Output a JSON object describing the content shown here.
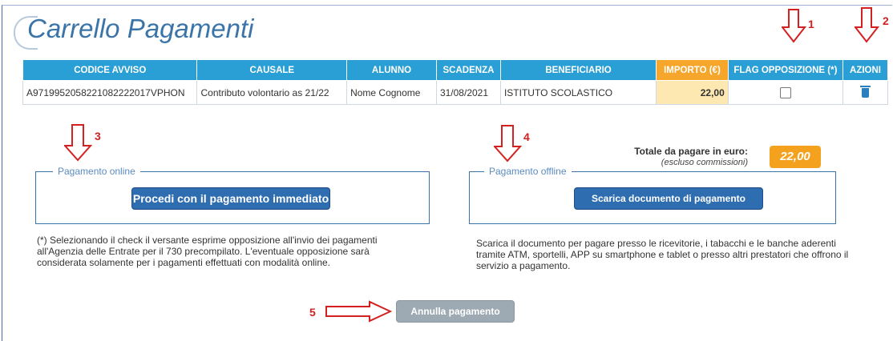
{
  "page": {
    "title": "Carrello Pagamenti"
  },
  "table": {
    "headers": {
      "codice_avviso": "CODICE AVVISO",
      "causale": "CAUSALE",
      "alunno": "ALUNNO",
      "scadenza": "SCADENZA",
      "beneficiario": "BENEFICIARIO",
      "importo": "IMPORTO (€)",
      "flag_opposizione": "FLAG OPPOSIZIONE (*)",
      "azioni": "AZIONI"
    },
    "row": {
      "codice_avviso": "A9719952058221082222017VPHON",
      "causale": "Contributo volontario as 21/22",
      "alunno": "Nome Cognome",
      "scadenza": "31/08/2021",
      "beneficiario": "ISTITUTO SCOLASTICO",
      "importo": "22,00",
      "flag_opposizione_checked": false,
      "azione_icon": "trash-icon"
    }
  },
  "totale": {
    "label": "Totale da pagare in euro:",
    "sublabel": "(escluso commissioni)",
    "value": "22,00"
  },
  "online": {
    "legend": "Pagamento online",
    "button": "Procedi con il pagamento immediato",
    "note": "(*) Selezionando il check il versante esprime opposizione all'invio dei pagamenti all'Agenzia delle Entrate per il 730 precompilato. L'eventuale opposizione sarà considerata solamente per i pagamenti effettuati con modalità online."
  },
  "offline": {
    "legend": "Pagamento offline",
    "button": "Scarica documento di pagamento",
    "note": "Scarica il documento per pagare presso le ricevitorie, i tabacchi e le banche aderenti tramite ATM, sportelli, APP su smartphone e tablet o presso altri prestatori che offrono il servizio a pagamento."
  },
  "cancel_button": "Annulla pagamento",
  "annotations": {
    "n1": "1",
    "n2": "2",
    "n3": "3",
    "n4": "4",
    "n5": "5"
  },
  "colors": {
    "header_blue": "#2a9fd6",
    "header_orange": "#f6a62b",
    "importo_cell": "#fce8b0",
    "primary_button": "#2f6db1",
    "total_box": "#f4a21e",
    "annotation_red": "#d32020"
  }
}
